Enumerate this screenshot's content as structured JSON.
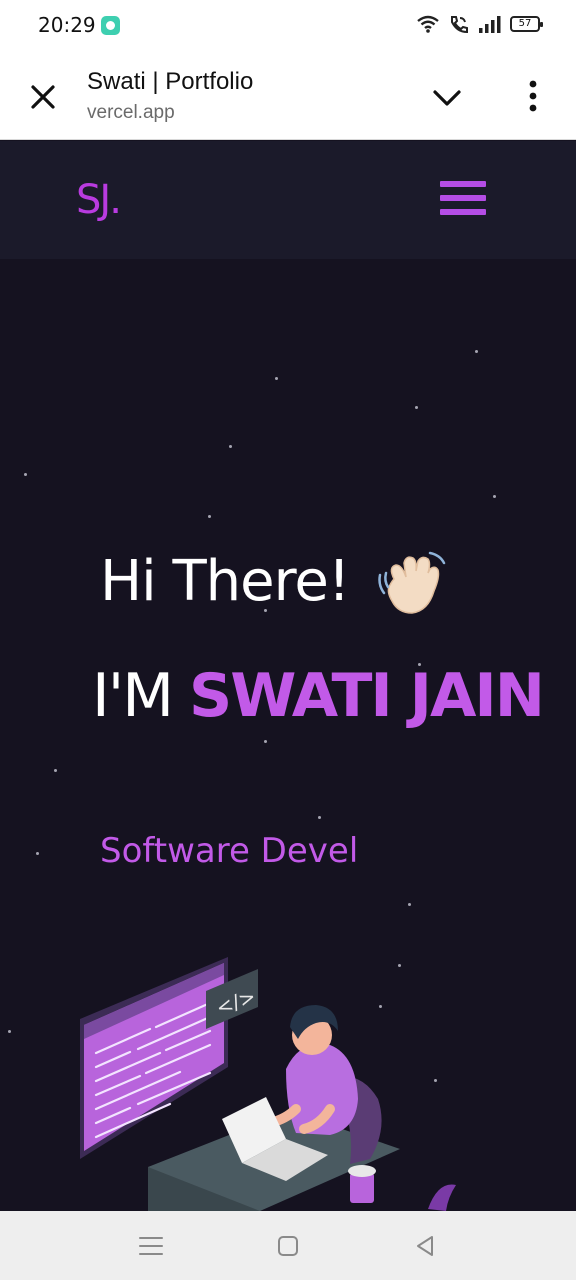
{
  "status_bar": {
    "time": "20:29",
    "battery": "57"
  },
  "browser": {
    "title": "Swati | Portfolio",
    "url": "vercel.app"
  },
  "nav": {
    "logo": "SJ."
  },
  "hero": {
    "greeting": "Hi There!",
    "intro_prefix": "I'M ",
    "name": "SWATI JAIN",
    "role": "Software Devel"
  },
  "colors": {
    "accent": "#c25ae8",
    "nav_bg": "#1b1a2a",
    "hero_bg": "#151220"
  },
  "icons": [
    "close-icon",
    "chevron-down-icon",
    "more-vert-icon",
    "hamburger-icon",
    "waving-hand-icon",
    "menu-nav-icon",
    "home-nav-icon",
    "back-nav-icon"
  ]
}
